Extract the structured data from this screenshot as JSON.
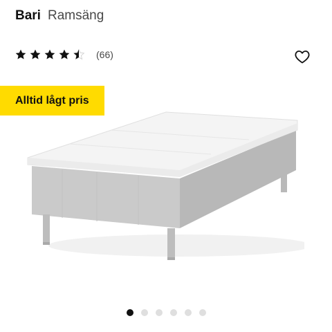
{
  "product": {
    "name": "Bari",
    "variant": "Ramsäng"
  },
  "rating": {
    "value": 4.5,
    "max": 5,
    "count_label": "(66)"
  },
  "favorite_icon": "heart-outline-icon",
  "badge": {
    "label": "Alltid lågt pris",
    "color": "#ffdb00"
  },
  "image": {
    "subject": "bed-with-mattress-topper",
    "colors": {
      "upholstery": "#c9c9c9",
      "topper": "#f4f4f4",
      "legs": "#bdbdbd"
    }
  },
  "carousel": {
    "total": 6,
    "active_index": 0
  }
}
